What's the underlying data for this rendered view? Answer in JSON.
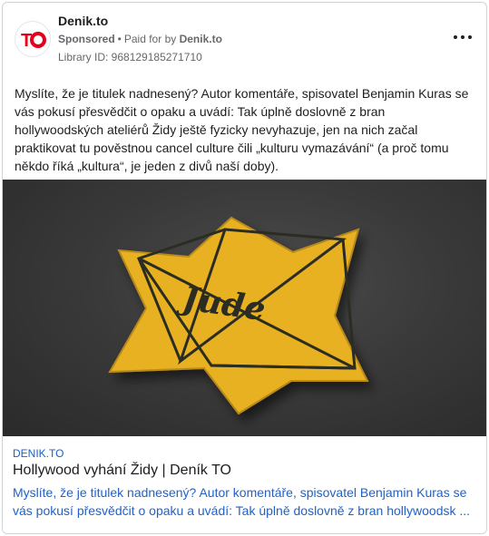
{
  "post": {
    "page_name": "Denik.to",
    "sponsored_label": "Sponsored",
    "separator": "•",
    "paid_for_prefix": "Paid for by",
    "advertiser": "Denik.to",
    "library_id": "Library ID: 968129185271710",
    "body": "Myslíte, že je titulek nadnesený? Autor komentáře, spisovatel Benjamin Kuras se vás pokusí přesvědčit o opaku a uvádí: Tak úplně doslovně z bran hollywoodských ateliérů Židy ještě fyzicky nevyhazuje, jen na nich začal praktikovat tu pověstnou cancel culture čili „kulturu vymazávání“ (a proč tomu někdo říká „kultura“, je jeden z divů naší doby).",
    "more_icon": "more-horizontal-icon",
    "avatar_icon": "denik-to-logo"
  },
  "media": {
    "badge_word": "Jude",
    "colors": {
      "star": "#e7b122",
      "outline": "#2b2c22",
      "background": "#3a3a3a"
    }
  },
  "link": {
    "domain": "DENIK.TO",
    "title": "Hollywood vyhání Židy | Deník TO",
    "description": "Myslíte, že je titulek nadnesený? Autor komentáře, spisovatel Benjamin Kuras se vás pokusí přesvědčit o opaku a uvádí: Tak úplně doslovně z bran hollywoodsk ..."
  },
  "colors": {
    "brand_red": "#e3001b",
    "link_blue": "#1a5fc6",
    "muted": "#65676b"
  }
}
